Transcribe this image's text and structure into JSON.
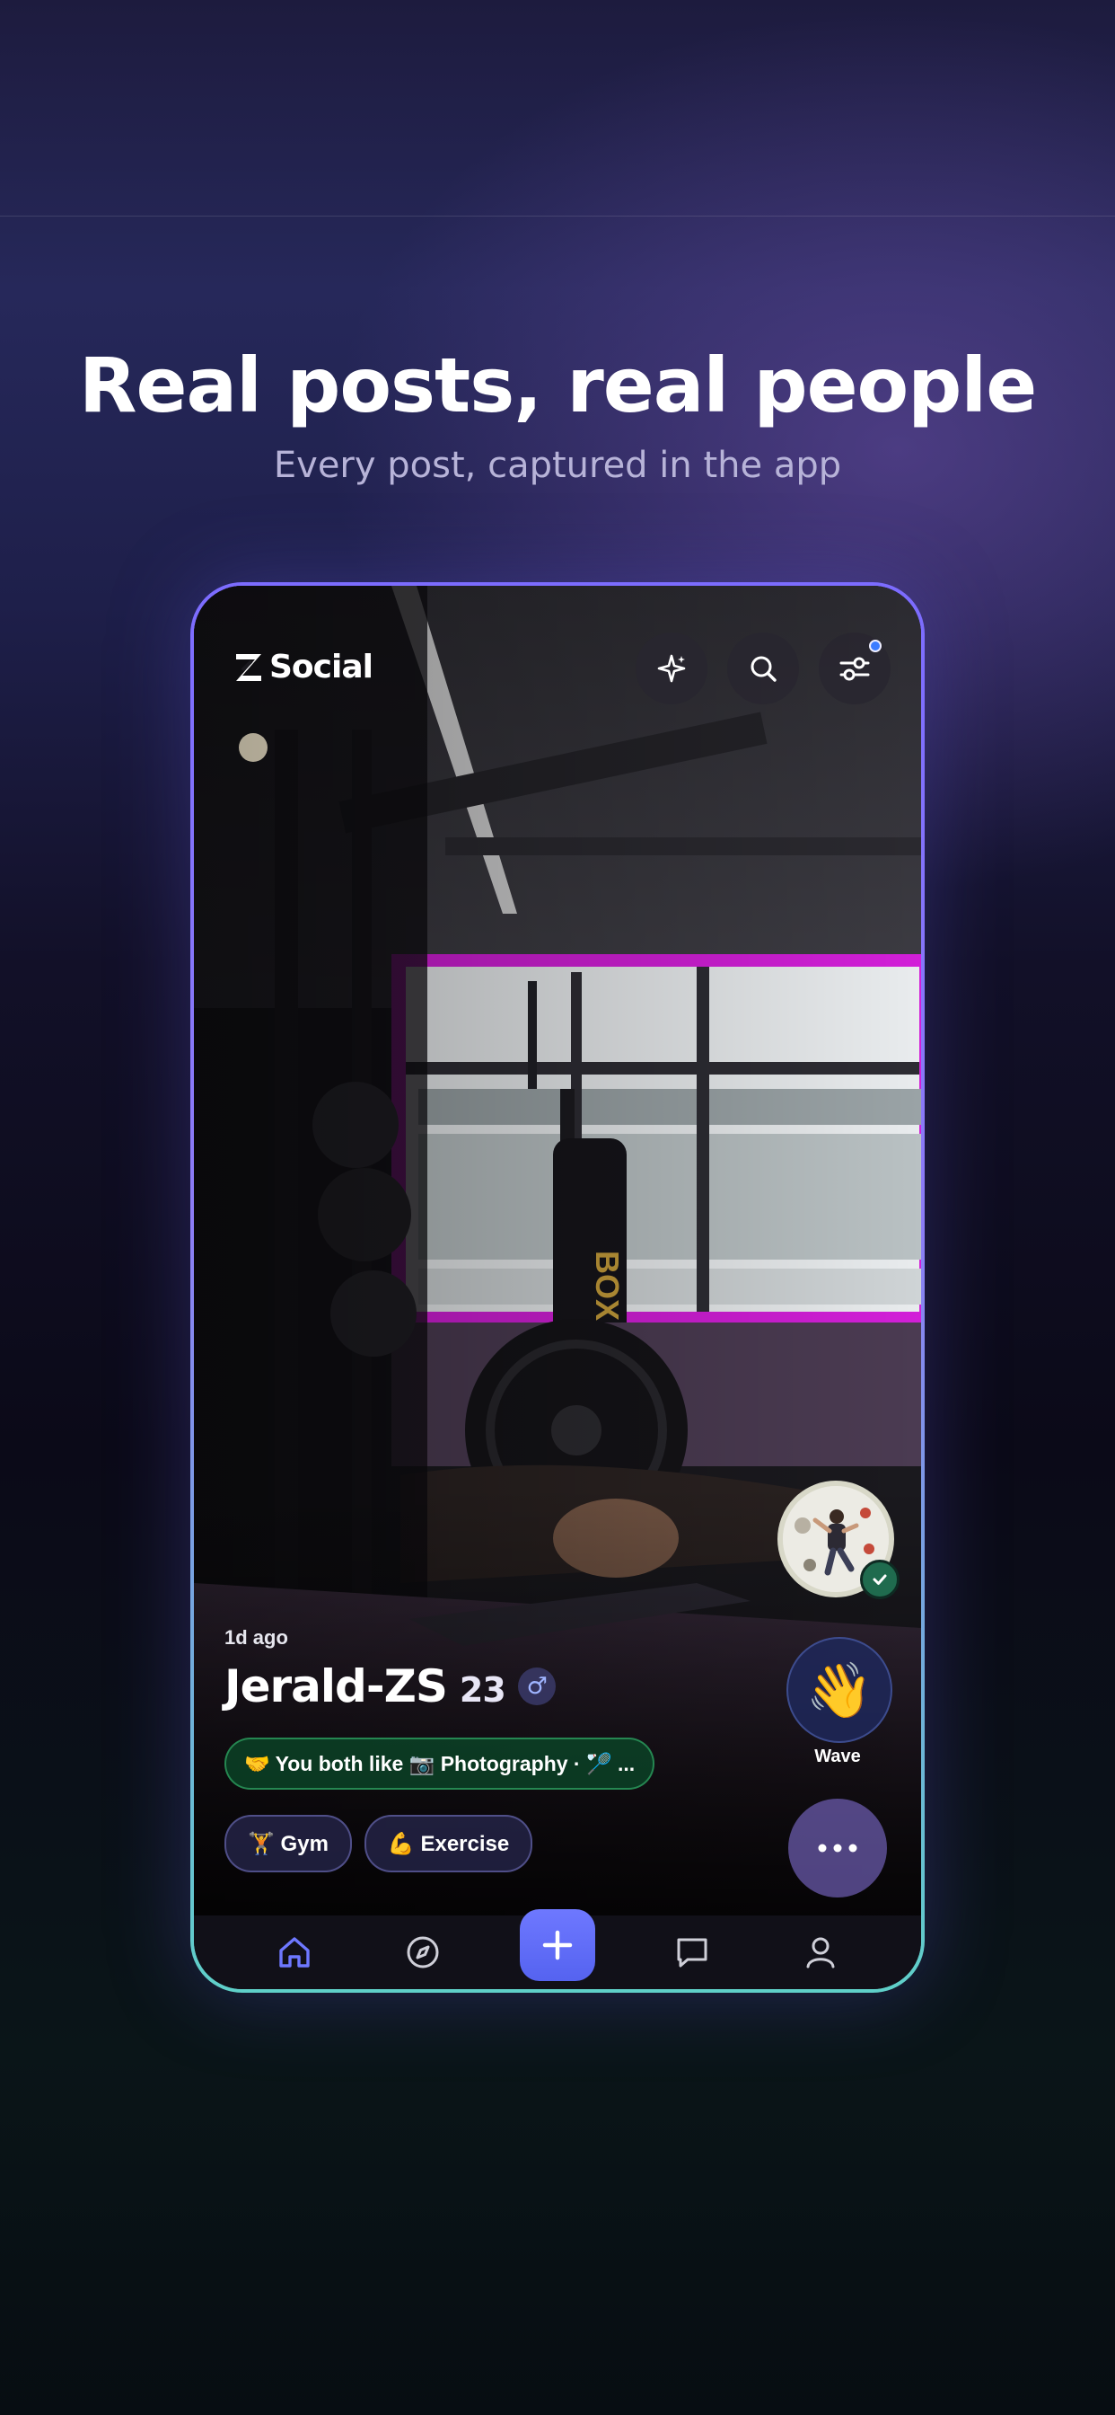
{
  "headline": "Real posts, real people",
  "subheadline": "Every post, captured in the app",
  "app": {
    "brand": "Social",
    "header_icons": [
      "sparkle-icon",
      "search-icon",
      "filter-sliders-icon"
    ],
    "filter_badge": true
  },
  "post": {
    "time_ago": "1d ago",
    "name": "Jerald-ZS",
    "age": "23",
    "gender_symbol": "♂",
    "shared_interests": "🤝 You both like 📷 Photography · 🏸 ...",
    "tags": [
      {
        "label": "🏋️ Gym"
      },
      {
        "label": "💪 Exercise"
      }
    ],
    "verified": true
  },
  "actions": {
    "wave_label": "Wave",
    "wave_emoji": "👋",
    "more_label": "···"
  },
  "tabbar": {
    "items": [
      "home-icon",
      "compass-icon",
      "add-icon",
      "chat-icon",
      "profile-icon"
    ],
    "active": "home-icon"
  },
  "colors": {
    "accent": "#6e78ff",
    "phone_border_top": "#7c6cff",
    "phone_border_bottom": "#5fd0c9",
    "shared_bg": "#0a4628",
    "verified": "#1f6b4e"
  }
}
